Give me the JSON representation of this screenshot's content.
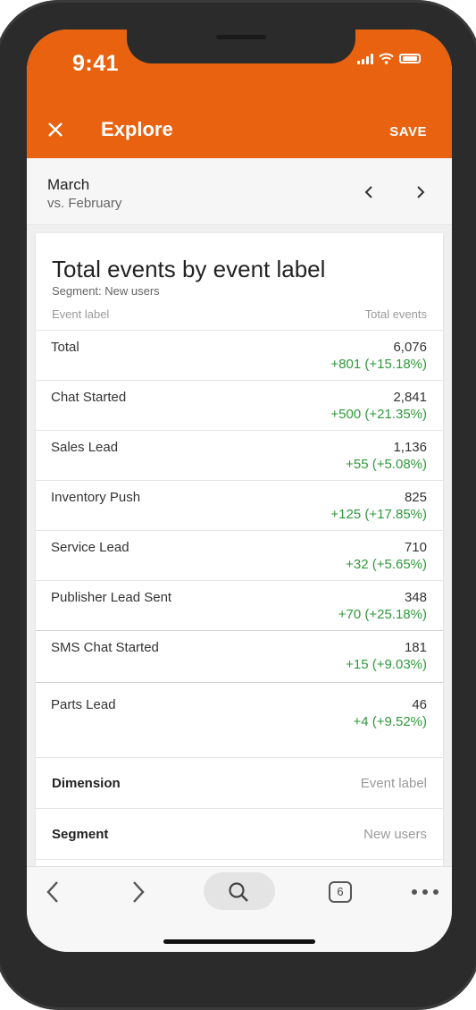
{
  "status": {
    "time": "9:41"
  },
  "header": {
    "title": "Explore",
    "save_label": "SAVE",
    "color": "#e8620f"
  },
  "date": {
    "current": "March",
    "compare": "vs. February"
  },
  "card": {
    "title": "Total events by event label",
    "segment_line": "Segment: New users",
    "col_label": "Event label",
    "col_value": "Total events",
    "rows": [
      {
        "label": "Total",
        "value": "6,076",
        "change": "+801 (+15.18%)"
      },
      {
        "label": "Chat Started",
        "value": "2,841",
        "change": "+500 (+21.35%)"
      },
      {
        "label": "Sales Lead",
        "value": "1,136",
        "change": "+55 (+5.08%)"
      },
      {
        "label": "Inventory Push",
        "value": "825",
        "change": "+125 (+17.85%)"
      },
      {
        "label": "Service Lead",
        "value": "710",
        "change": "+32 (+5.65%)"
      },
      {
        "label": "Publisher Lead Sent",
        "value": "348",
        "change": "+70 (+25.18%)"
      },
      {
        "label": "SMS Chat Started",
        "value": "181",
        "change": "+15 (+9.03%)"
      },
      {
        "label": "Parts Lead",
        "value": "46",
        "change": "+4 (+9.52%)"
      }
    ],
    "dimension": {
      "label": "Dimension",
      "value": "Event label"
    },
    "segment": {
      "label": "Segment",
      "value": "New users"
    },
    "view_tabs": [
      "bar-chart-icon",
      "horizontal-bar-icon",
      "table-icon"
    ],
    "active_view": "table-icon"
  },
  "browser": {
    "tab_count": "6"
  }
}
